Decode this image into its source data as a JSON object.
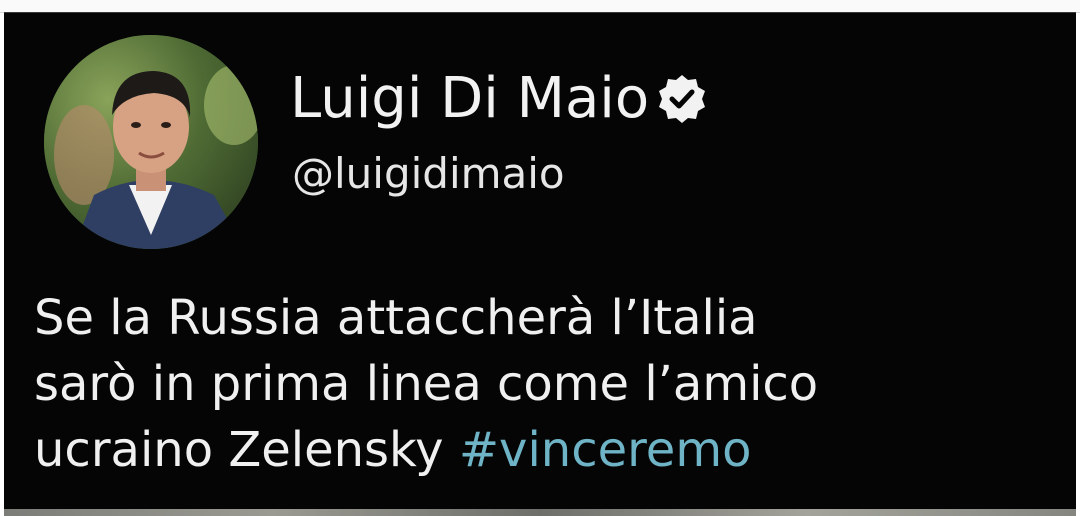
{
  "tweet": {
    "display_name": "Luigi Di Maio",
    "handle": "@luigidimaio",
    "verified": true,
    "text_lines": [
      "Se la Russia attaccherà l’Italia",
      "sarò in prima linea come l’amico"
    ],
    "text_line3_plain": "ucraino Zelensky ",
    "hashtag": "#vinceremo"
  },
  "icons": {
    "avatar": "profile-photo",
    "verified": "verified-badge-icon"
  },
  "colors": {
    "background": "#050505",
    "text": "#f0f0f0",
    "hashtag": "#6fb4c6"
  }
}
